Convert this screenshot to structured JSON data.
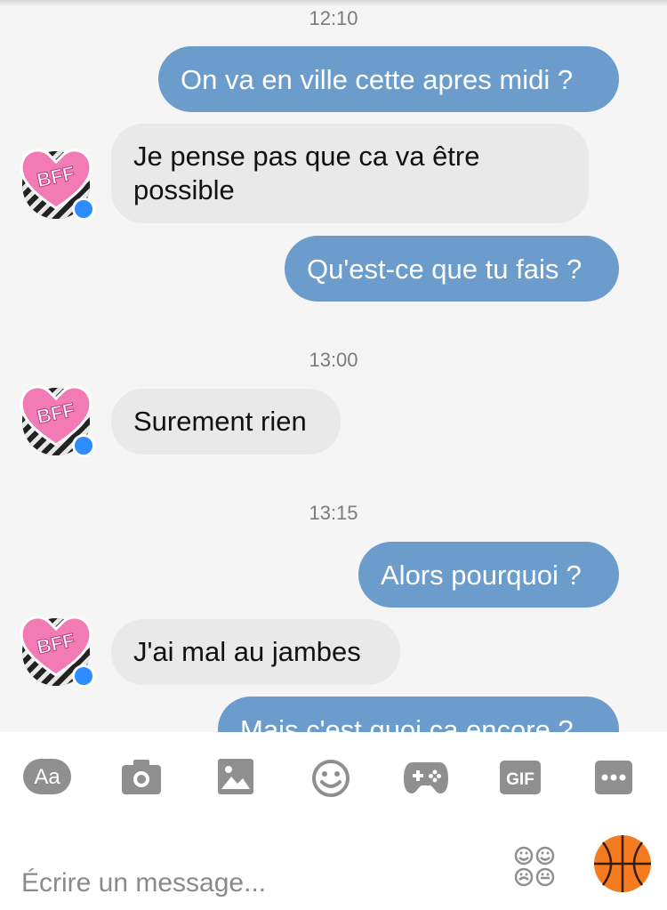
{
  "timestamps": [
    "12:10",
    "13:00",
    "13:15"
  ],
  "messages": [
    {
      "text": "On va en ville cette apres midi ?"
    },
    {
      "text": "Je pense pas que ca va être possible"
    },
    {
      "text": "Qu'est-ce que tu fais ?"
    },
    {
      "text": "Surement rien"
    },
    {
      "text": "Alors pourquoi ?"
    },
    {
      "text": "J'ai mal au jambes"
    },
    {
      "text": "Mais c'est quoi ca encore ?"
    }
  ],
  "avatar": {
    "label": "BFF",
    "heart_color": "#f37bb5",
    "badge_color": "#2d8cff"
  },
  "composer": {
    "placeholder": "Écrire un message...",
    "tools": {
      "text_label": "Aa",
      "gif_label": "GIF"
    }
  },
  "colors": {
    "outgoing": "#6b9ccc",
    "incoming": "#e9e9e9",
    "icon": "#8f8f8f",
    "ball": "#f47b20"
  }
}
